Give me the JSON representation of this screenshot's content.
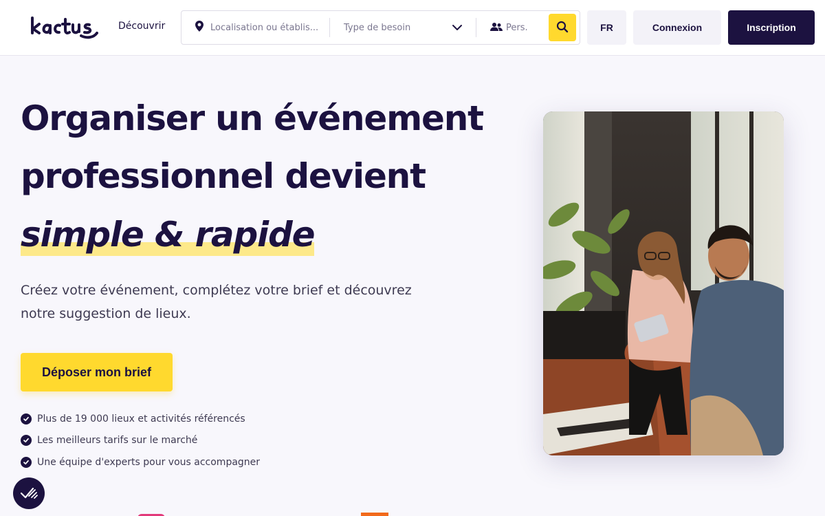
{
  "header": {
    "logo_text": "kactus",
    "nav_discover": "Découvrir",
    "search": {
      "location_placeholder": "Localisation ou établis...",
      "type_placeholder": "Type de besoin",
      "people_placeholder": "Pers."
    },
    "lang": "FR",
    "login": "Connexion",
    "signup": "Inscription"
  },
  "hero": {
    "title_line1": "Organiser un événement",
    "title_line2": "professionnel devient",
    "title_accent": "simple & rapide",
    "subtitle": "Créez votre événement, complétez votre brief et découvrez notre suggestion de lieux.",
    "cta": "Déposer mon brief",
    "features": [
      "Plus de 19 000 lieux et activités référencés",
      "Les meilleurs tarifs sur le marché",
      "Une équipe d'experts pour vous accompagner"
    ]
  },
  "colors": {
    "brand_dark": "#1c1240",
    "accent_yellow": "#ffd92e",
    "highlight_yellow": "#fde98a",
    "background": "#f8f7fc"
  },
  "icons": {
    "location": "map-pin-icon",
    "chevron": "chevron-down-icon",
    "people": "users-icon",
    "search": "search-icon",
    "check": "check-circle-icon",
    "accessibility": "accessibility-icon"
  }
}
